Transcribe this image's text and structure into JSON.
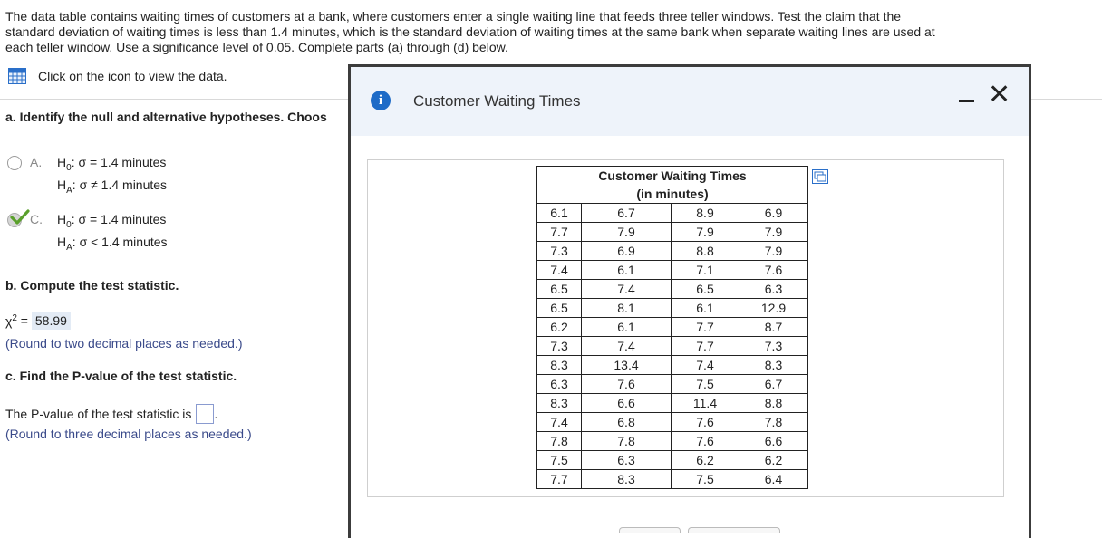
{
  "intro": {
    "line1": "The data table contains waiting times of customers at a bank, where customers enter a single waiting line that feeds three teller windows. Test the claim that the",
    "line2": "standard deviation of waiting times is less than 1.4 minutes, which is the standard deviation of waiting times at the same bank when separate waiting lines are used at",
    "line3": "each teller window. Use a significance level of 0.05. Complete parts (a) through (d) below."
  },
  "data_link": {
    "label": "Click on the icon to view the data.",
    "icon": "table-grid-icon"
  },
  "part_a": {
    "prompt": "a. Identify the null and alternative hypotheses. Choos",
    "option_a": {
      "letter": "A.",
      "h0_pre": "H",
      "h0_sub": "0",
      "h0_rest": ": σ = 1.4 minutes",
      "ha_pre": "H",
      "ha_sub": "A",
      "ha_rest": ": σ ≠ 1.4 minutes",
      "selected": false
    },
    "option_c": {
      "letter": "C.",
      "h0_pre": "H",
      "h0_sub": "0",
      "h0_rest": ": σ = 1.4 minutes",
      "ha_pre": "H",
      "ha_sub": "A",
      "ha_rest": ": σ < 1.4 minutes",
      "selected": true,
      "correct": true
    }
  },
  "part_b": {
    "prompt": "b. Compute the test statistic.",
    "statistic_label": "χ",
    "statistic_sup": "2",
    "equals": " = ",
    "answer": "58.99",
    "hint": "(Round to two decimal places as needed.)"
  },
  "part_c": {
    "prompt": "c. Find the P-value of the test statistic.",
    "answer_label": "The P-value of the test statistic is",
    "answer_value": "",
    "period": ".",
    "hint": "(Round to three decimal places as needed.)"
  },
  "dialog": {
    "title": "Customer Waiting Times",
    "info_icon": "i",
    "close_label": "✕",
    "table": {
      "caption_line1": "Customer Waiting Times",
      "caption_line2": "(in minutes)",
      "rows": [
        [
          "6.1",
          "6.7",
          "8.9",
          "6.9"
        ],
        [
          "7.7",
          "7.9",
          "7.9",
          "7.9"
        ],
        [
          "7.3",
          "6.9",
          "8.8",
          "7.9"
        ],
        [
          "7.4",
          "6.1",
          "7.1",
          "7.6"
        ],
        [
          "6.5",
          "7.4",
          "6.5",
          "6.3"
        ],
        [
          "6.5",
          "8.1",
          "6.1",
          "12.9"
        ],
        [
          "6.2",
          "6.1",
          "7.7",
          "8.7"
        ],
        [
          "7.3",
          "7.4",
          "7.7",
          "7.3"
        ],
        [
          "8.3",
          "13.4",
          "7.4",
          "8.3"
        ],
        [
          "6.3",
          "7.6",
          "7.5",
          "6.7"
        ],
        [
          "8.3",
          "6.6",
          "11.4",
          "8.8"
        ],
        [
          "7.4",
          "6.8",
          "7.6",
          "7.8"
        ],
        [
          "7.8",
          "7.8",
          "7.6",
          "6.6"
        ],
        [
          "7.5",
          "6.3",
          "6.2",
          "6.2"
        ],
        [
          "7.7",
          "8.3",
          "7.5",
          "6.4"
        ]
      ]
    }
  },
  "colors": {
    "accent": "#1e6bc7",
    "check": "#5aa02c",
    "answer_bg": "#e3ebf5",
    "hint_text": "#3a4a8a",
    "dialog_head": "#eef3fa"
  }
}
